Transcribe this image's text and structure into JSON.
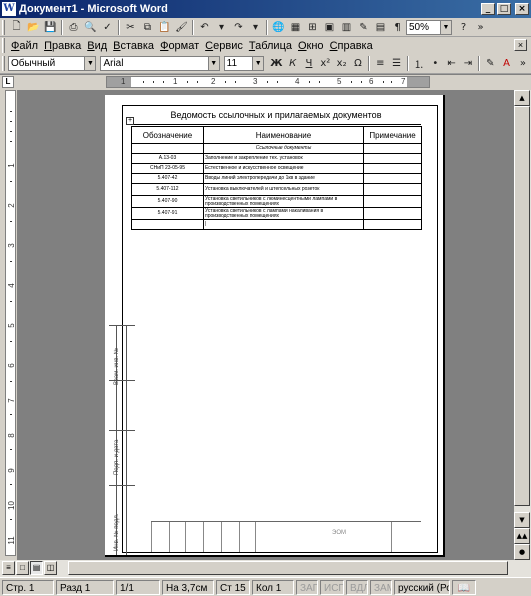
{
  "window": {
    "title": "Документ1 - Microsoft Word",
    "app_icon": "W",
    "buttons": [
      "_",
      "□",
      "×"
    ]
  },
  "standard_toolbar": {
    "zoom": "50%",
    "help": "?"
  },
  "menu": {
    "items": [
      "Файл",
      "Правка",
      "Вид",
      "Вставка",
      "Формат",
      "Сервис",
      "Таблица",
      "Окно",
      "Справка"
    ],
    "doc_close": "×"
  },
  "formatting_toolbar": {
    "style": "Обычный",
    "font": "Arial",
    "size": "11",
    "bold": "Ж",
    "italic": "К",
    "underline": "Ч"
  },
  "ruler": {
    "numbers": [
      "1",
      "1",
      "2",
      "3",
      "4",
      "5",
      "6",
      "7"
    ]
  },
  "vruler": {
    "numbers": [
      "1",
      "2",
      "3",
      "4",
      "5",
      "6",
      "7",
      "8",
      "9",
      "10",
      "11"
    ]
  },
  "document": {
    "title": "Ведомость ссылочных и прилагаемых документов",
    "anchor": "+",
    "headers": [
      "Обозначение",
      "Наименование",
      "Примечание"
    ],
    "group_label": "Ссылочные документы",
    "rows": [
      {
        "code": "А.13-03",
        "name": "Заполнение и закрепление тех. установок"
      },
      {
        "code": "СНиП 23-05-95",
        "name": "Естественное и искусственное освещение"
      },
      {
        "code": "5.407-42",
        "name": "Вводы линий электропередачи до 1кв в здание"
      },
      {
        "code": "5.407-112",
        "name": "Установка выключателей и штепсельных розеток"
      },
      {
        "code": "5.407-90",
        "name": "Установка светильников с люминесцентными лампами в производственных помещениях"
      },
      {
        "code": "5.407-91",
        "name": "Установка светильников с лампами накаливания в производственных помещениях"
      }
    ],
    "side_labels": [
      "Взам. инв. №",
      "Подп. и дата",
      "Инв. № подл."
    ],
    "stamp_number": "ЭОМ"
  },
  "view_buttons": [
    "≡",
    "□",
    "▤",
    "◫"
  ],
  "status": {
    "page": "Стр. 1",
    "section": "Разд 1",
    "pages": "1/1",
    "at": "На 3,7см",
    "line": "Ст 15",
    "col": "Кол 1",
    "rec": "ЗАП",
    "trk": "ИСПР",
    "ext": "ВДЛ",
    "ovr": "ЗАМ",
    "lang": "русский (Рос",
    "book_icon": "📖"
  },
  "colors": {
    "titlebar_start": "#0a246a",
    "titlebar_end": "#3a6ea5",
    "chrome": "#d4d0c8",
    "workspace": "#808080"
  }
}
